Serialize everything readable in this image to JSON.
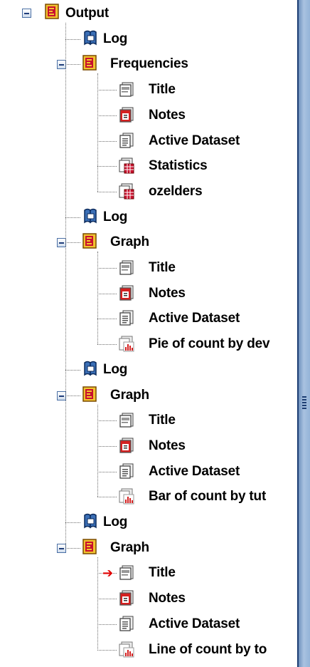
{
  "tree": {
    "root": {
      "label": "Output",
      "icon": "output-book-icon"
    },
    "items": [
      {
        "label": "Log",
        "icon": "log-icon"
      },
      {
        "label": "Frequencies",
        "icon": "procedure-book-icon",
        "children": [
          {
            "label": "Title",
            "icon": "title-icon"
          },
          {
            "label": "Notes",
            "icon": "notes-icon"
          },
          {
            "label": "Active Dataset",
            "icon": "dataset-icon"
          },
          {
            "label": "Statistics",
            "icon": "table-icon"
          },
          {
            "label": "ozelders",
            "icon": "table-icon"
          }
        ]
      },
      {
        "label": "Log",
        "icon": "log-icon"
      },
      {
        "label": "Graph",
        "icon": "procedure-book-icon",
        "children": [
          {
            "label": "Title",
            "icon": "title-icon"
          },
          {
            "label": "Notes",
            "icon": "notes-icon"
          },
          {
            "label": "Active Dataset",
            "icon": "dataset-icon"
          },
          {
            "label": "Pie of count by dev",
            "icon": "chart-icon"
          }
        ]
      },
      {
        "label": "Log",
        "icon": "log-icon"
      },
      {
        "label": "Graph",
        "icon": "procedure-book-icon",
        "children": [
          {
            "label": "Title",
            "icon": "title-icon"
          },
          {
            "label": "Notes",
            "icon": "notes-icon"
          },
          {
            "label": "Active Dataset",
            "icon": "dataset-icon"
          },
          {
            "label": "Bar of count by tut",
            "icon": "chart-icon"
          }
        ]
      },
      {
        "label": "Log",
        "icon": "log-icon"
      },
      {
        "label": "Graph",
        "icon": "procedure-book-icon",
        "children": [
          {
            "label": "Title",
            "icon": "title-icon",
            "current": true
          },
          {
            "label": "Notes",
            "icon": "notes-icon"
          },
          {
            "label": "Active Dataset",
            "icon": "dataset-icon"
          },
          {
            "label": "Line of count by to",
            "icon": "chart-icon"
          }
        ]
      }
    ]
  },
  "colors": {
    "accent": "#1d3e73",
    "book_red": "#c8102e",
    "book_yellow": "#f2c230",
    "current_arrow": "#e00000"
  }
}
